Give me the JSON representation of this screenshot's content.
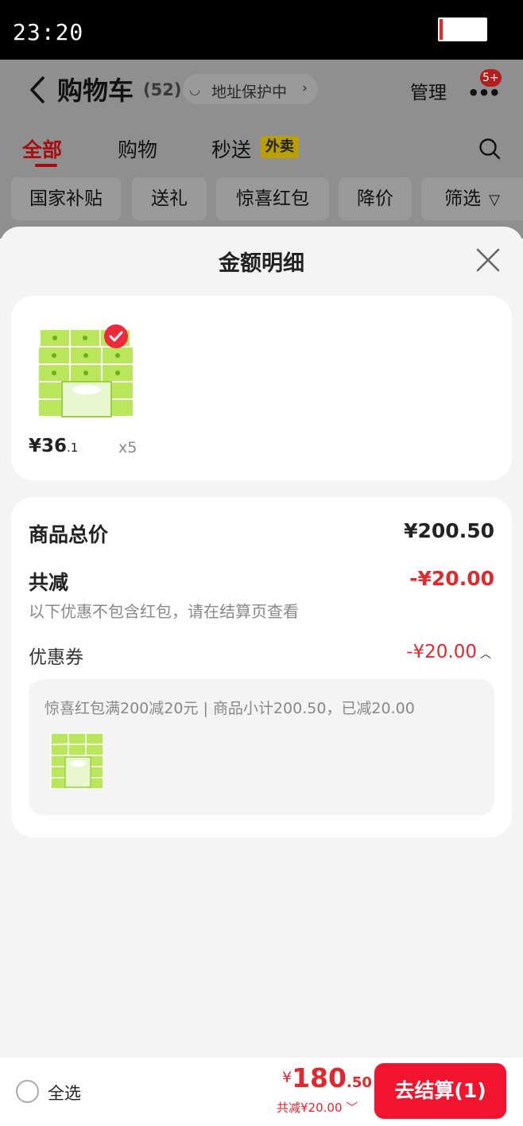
{
  "status_bar": {
    "time": "23:20"
  },
  "cart_header": {
    "title": "购物车",
    "count": "(52)",
    "address": "地址保护中",
    "manage": "管理",
    "badge": "5+"
  },
  "tabs": [
    {
      "label": "全部",
      "active": true
    },
    {
      "label": "购物",
      "active": false
    },
    {
      "label": "秒送",
      "active": false
    }
  ],
  "tab_tag": "外卖",
  "filters": [
    "国家补贴",
    "送礼",
    "惊喜红包",
    "降价",
    "筛选"
  ],
  "sheet": {
    "title": "金额明细"
  },
  "product": {
    "price_int": "¥36",
    "price_dec": ".1",
    "qty": "x5"
  },
  "summary": {
    "total_label": "商品总价",
    "total_value": "¥200.50",
    "discount_label": "共减",
    "discount_value": "-¥20.00",
    "note": "以下优惠不包含红包，请在结算页查看"
  },
  "coupon": {
    "label": "优惠券",
    "value": "-¥20.00",
    "desc": "惊喜红包满200减20元 | 商品小计200.50，已减20.00"
  },
  "bottom": {
    "select_all": "全选",
    "yen": "¥",
    "total_int": "180",
    "total_dec": ".50",
    "saved": "共减¥20.00",
    "checkout": "去结算(1)"
  },
  "colors": {
    "accent": "#f2132f",
    "discount": "#e0282f"
  }
}
